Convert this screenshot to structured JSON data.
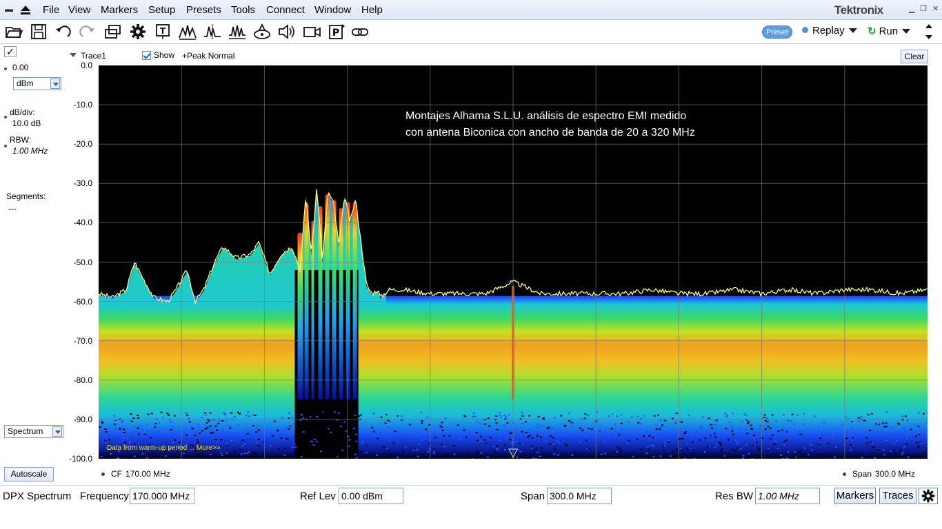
{
  "menubar": {
    "items": [
      "File",
      "View",
      "Markers",
      "Setup",
      "Presets",
      "Tools",
      "Connect",
      "Window",
      "Help"
    ],
    "brand": "Tektronix"
  },
  "toolbar": {
    "icons": [
      "open-folder-icon",
      "save-icon",
      "undo-icon",
      "redo-icon",
      "windows-icon",
      "gear-icon",
      "text-marker-icon",
      "peaks-icon",
      "spectrum-icon",
      "waveform-icon",
      "record-icon",
      "speaker-icon",
      "camera-icon",
      "preset-icon",
      "link-icon"
    ],
    "preset_label": "Preset",
    "replay_label": "Replay",
    "run_label": "Run"
  },
  "left_panel": {
    "checkmark": "✓",
    "ref_value": "0.00",
    "unit": "dBm",
    "dbdiv_label": "dB/div:",
    "dbdiv_value": "10.0 dB",
    "rbw_label": "RBW:",
    "rbw_value": "1.00 MHz",
    "segments_label": "Segments:",
    "segments_value": "---",
    "display_select": "Spectrum",
    "autoscale_label": "Autoscale"
  },
  "trace_header": {
    "trace_name": "Trace1",
    "show_label": "Show",
    "show_checked": true,
    "detection": "+Peak Normal",
    "clear_label": "Clear"
  },
  "plot": {
    "annotation_line1": "Montajes Alhama S.L.U.  análisis de espectro EMI medido",
    "annotation_line2": "con antena Biconica con ancho de banda de 20 a 320 MHz",
    "warmup_text": "Data from warm-up period ... More>>",
    "cf_label": "CF",
    "cf_value": "170.00 MHz",
    "span_label": "Span",
    "span_value": "300.0 MHz"
  },
  "chart_data": {
    "type": "line",
    "ylabel_ticks": [
      "0.0",
      "-10.0",
      "-20.0",
      "-30.0",
      "-40.0",
      "-50.0",
      "-60.0",
      "-70.0",
      "-80.0",
      "-90.0",
      "-100.0"
    ],
    "ylim": [
      -100,
      0
    ],
    "xlim_mhz": [
      20,
      320
    ],
    "grid": true,
    "series": [
      {
        "x": [
          20,
          25,
          30,
          33,
          36,
          40,
          45,
          48,
          52,
          55,
          58,
          62,
          65,
          70,
          75,
          78,
          82,
          86,
          90,
          93,
          95,
          97,
          99,
          101,
          103,
          105,
          107,
          109,
          111,
          113,
          115,
          117,
          119,
          121,
          122,
          125,
          130,
          140,
          150,
          160,
          170,
          180,
          190,
          200,
          210,
          220,
          230,
          240,
          250,
          260,
          270,
          280,
          290,
          300,
          310,
          320
        ],
        "y": [
          -58,
          -59,
          -57,
          -50,
          -54,
          -59,
          -60,
          -57,
          -52,
          -60,
          -57,
          -50,
          -46,
          -49,
          -48,
          -45,
          -53,
          -48,
          -46,
          -52,
          -33,
          -48,
          -31,
          -50,
          -32,
          -35,
          -46,
          -33,
          -40,
          -34,
          -45,
          -56,
          -58,
          -57,
          -59,
          -57,
          -57,
          -58,
          -58,
          -58,
          -55,
          -58,
          -58,
          -58,
          -58,
          -57,
          -58,
          -58,
          -57,
          -58,
          -57,
          -58,
          -57,
          -57,
          -58,
          -57
        ]
      }
    ],
    "colors": {
      "background": "#000000",
      "trace": "#ffff80",
      "grid": "#777777"
    }
  },
  "bottom_bar": {
    "mode": "DPX Spectrum",
    "freq_label": "Frequency",
    "freq_value": "170.000 MHz",
    "reflev_label": "Ref Lev",
    "reflev_value": "0.00 dBm",
    "span_label": "Span",
    "span_value": "300.0 MHz",
    "resbw_label": "Res BW",
    "resbw_value": "1.00 MHz",
    "markers_label": "Markers",
    "traces_label": "Traces"
  }
}
